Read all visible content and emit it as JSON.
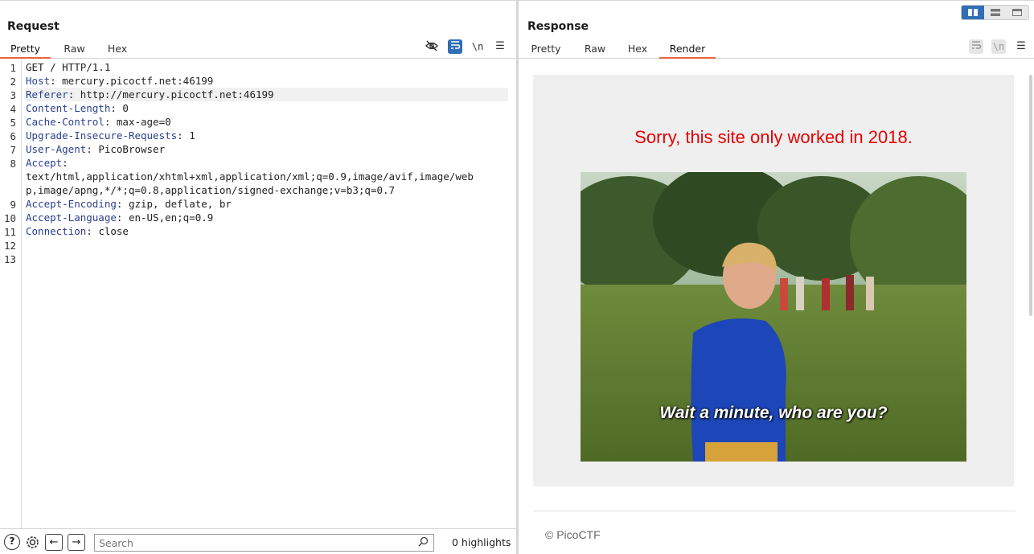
{
  "request": {
    "title": "Request",
    "tabs": [
      "Pretty",
      "Raw",
      "Hex"
    ],
    "active_tab": "Pretty",
    "toolbar": {
      "hide_icon": "eye-off-icon",
      "wrap_icon": "wrap-icon",
      "newline_label": "\\n",
      "menu_icon": "menu-icon"
    },
    "line_numbers": [
      "1",
      "2",
      "3",
      "4",
      "5",
      "6",
      "7",
      "8",
      "",
      "",
      "9",
      "10",
      "11",
      "12",
      "13"
    ],
    "lines": [
      {
        "key": "",
        "value": "GET / HTTP/1.1"
      },
      {
        "key": "Host",
        "value": ": mercury.picoctf.net:46199"
      },
      {
        "key": "Referer",
        "value": ": http://mercury.picoctf.net:46199"
      },
      {
        "key": "Content-Length",
        "value": ": 0"
      },
      {
        "key": "Cache-Control",
        "value": ": max-age=0"
      },
      {
        "key": "Upgrade-Insecure-Requests",
        "value": ": 1"
      },
      {
        "key": "User-Agent",
        "value": ": PicoBrowser"
      },
      {
        "key": "Accept",
        "value": ":"
      },
      {
        "key": "",
        "value": "text/html,application/xhtml+xml,application/xml;q=0.9,image/avif,image/web"
      },
      {
        "key": "",
        "value": "p,image/apng,*/*;q=0.8,application/signed-exchange;v=b3;q=0.7"
      },
      {
        "key": "Accept-Encoding",
        "value": ": gzip, deflate, br"
      },
      {
        "key": "Accept-Language",
        "value": ": en-US,en;q=0.9"
      },
      {
        "key": "Connection",
        "value": ": close"
      },
      {
        "key": "",
        "value": ""
      },
      {
        "key": "",
        "value": ""
      }
    ],
    "highlighted_line": 2
  },
  "bottom_bar": {
    "help_label": "?",
    "settings_icon": "gear-icon",
    "back_label": "←",
    "forward_label": "→",
    "search_placeholder": "Search",
    "search_icon": "search-icon",
    "highlights_text": "0 highlights"
  },
  "response": {
    "title": "Response",
    "tabs": [
      "Pretty",
      "Raw",
      "Hex",
      "Render"
    ],
    "active_tab": "Render",
    "toolbar": {
      "wrap_icon": "wrap-icon",
      "newline_label": "\\n",
      "menu_icon": "menu-icon"
    },
    "render": {
      "message": "Sorry, this site only worked in 2018.",
      "gif_caption": "Wait a minute, who are you?",
      "footer": "© PicoCTF"
    }
  },
  "layout_toggle": {
    "options": [
      "split-horizontal-icon",
      "split-vertical-icon",
      "tabs-icon"
    ],
    "active": 0
  },
  "colors": {
    "accent": "#e8643c",
    "blue": "#2f6fb5",
    "header_key": "#2a3f8f",
    "render_message": "#e60000"
  }
}
